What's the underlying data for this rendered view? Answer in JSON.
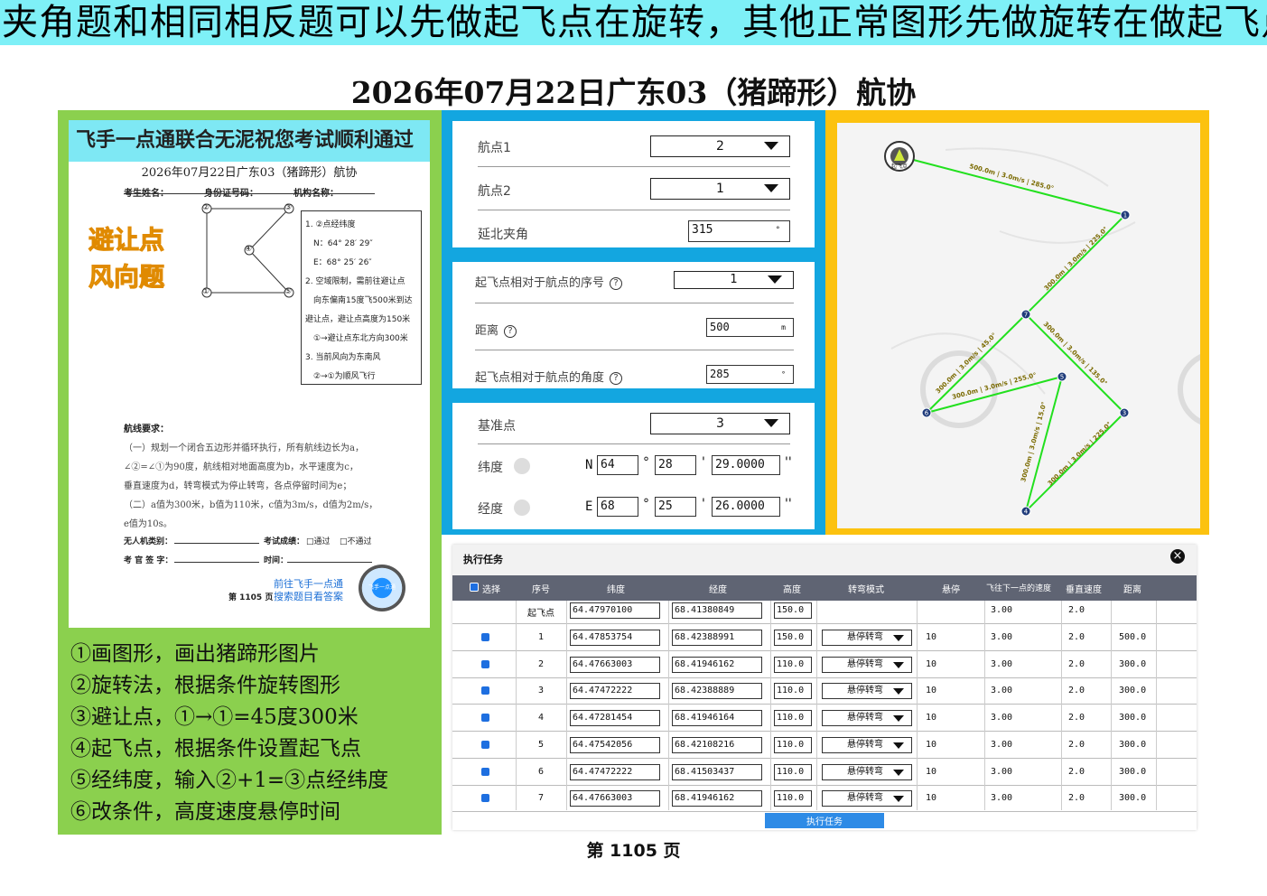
{
  "banner": {
    "text": "夹角题和相同相反题可以先做起飞点在旋转，其他正常图形先做旋转在做起飞点"
  },
  "title": "2026年07月22日广东03（猪蹄形）航协",
  "left": {
    "paper": {
      "header": "飞手一点通联合无泥祝您考试顺利通过",
      "title": "2026年07月22日广东03（猪蹄形）航协",
      "candidate_fields": [
        "考生姓名：",
        "身份证号码：",
        "机构名称："
      ],
      "tag_line1": "避让点",
      "tag_line2": "风向题",
      "conditions": [
        "1. ②点经纬度",
        "N：64° 28′ 29″",
        "E：68° 25′ 26″",
        "2. 空域限制，需前往避让点",
        "向东偏南15度飞500米到达",
        "避让点，避让点高度为150米",
        "①→避让点东北方向300米",
        "3. 当前风向为东南风",
        "②→①为顺风飞行"
      ],
      "route_title": "航线要求：",
      "route_lines": [
        "（一）规划一个闭合五边形并循环执行，所有航线边长为a，",
        "∠②=∠①为90度，航线相对地面高度为b，水平速度为c，",
        "垂直速度为d，转弯模式为停止转弯，各点停留时间为e；",
        "（二）a值为300米，b值为110米，c值为3m/s，d值为2m/s，",
        "e值为10s。"
      ],
      "uav_type": "无人机类别：",
      "result_label": "考试成绩：",
      "pass": "□通过",
      "fail": "□不通过",
      "examiner": "考 官 签 字：",
      "time_label": "时间：",
      "footer_link1": "前往飞手一点通",
      "footer_link2": "搜索题目看答案",
      "footer_page": "第 1105 页",
      "qr_label": "飞手一点通",
      "shape_points": [
        "②",
        "③",
        "④",
        "①",
        "⑤"
      ]
    },
    "steps": [
      "①画图形，画出猪蹄形图片",
      "②旋转法，根据条件旋转图形",
      "③避让点，①→①=45度300米",
      "④起飞点，根据条件设置起飞点",
      "⑤经纬度，输入②+1=③点经纬度",
      "⑥改条件，高度速度悬停时间"
    ]
  },
  "mid": {
    "box1": {
      "waypoint1_label": "航点1",
      "waypoint1_value": "2",
      "waypoint2_label": "航点2",
      "waypoint2_value": "1",
      "angle_label": "延北夹角",
      "angle_value": "315",
      "angle_unit": "°"
    },
    "box2": {
      "seq_label": "起飞点相对于航点的序号",
      "seq_value": "1",
      "dist_label": "距离",
      "dist_value": "500",
      "dist_unit": "m",
      "angle_label": "起飞点相对于航点的角度",
      "angle_value": "285",
      "angle_unit": "°"
    },
    "box3": {
      "base_label": "基准点",
      "base_value": "3",
      "lat_label": "纬度",
      "lat_prefix": "N",
      "lat_deg": "64",
      "lat_min": "28",
      "lat_sec": "29.0000",
      "lon_label": "经度",
      "lon_prefix": "E",
      "lon_deg": "68",
      "lon_min": "25",
      "lon_sec": "26.0000",
      "deg_sym": "°",
      "min_sym": "'",
      "sec_sym": "''"
    }
  },
  "map": {
    "home_label": "起飞点",
    "nodes": [
      "1",
      "7",
      "6",
      "5",
      "3",
      "4"
    ],
    "edge_labels": [
      "500.0m | 3.0m/s | 285.0°",
      "300.0m | 3.0m/s | 225.0°",
      "300.0m | 3.0m/s | 45.0°",
      "300.0m | 3.0m/s | 135.0°",
      "300.0m | 3.0m/s | 255.0°",
      "300.0m | 3.0m/s | 15.0°",
      "300.0m | 3.0m/s | 225.0°"
    ]
  },
  "task": {
    "title": "执行任务",
    "close": "×",
    "columns": [
      "选择",
      "序号",
      "纬度",
      "经度",
      "高度",
      "转弯模式",
      "悬停",
      "飞往下一点的速度",
      "垂直速度",
      "距离"
    ],
    "takeoff_row": {
      "seq": "起飞点",
      "lat": "64.47970100",
      "lon": "68.41380849",
      "alt": "150.0",
      "speed": "3.00",
      "vspeed": "2.0"
    },
    "rows": [
      {
        "seq": "1",
        "lat": "64.47853754",
        "lon": "68.42388991",
        "alt": "150.0",
        "mode": "悬停转弯",
        "hover": "10",
        "speed": "3.00",
        "vspeed": "2.0",
        "dist": "500.0"
      },
      {
        "seq": "2",
        "lat": "64.47663003",
        "lon": "68.41946162",
        "alt": "110.0",
        "mode": "悬停转弯",
        "hover": "10",
        "speed": "3.00",
        "vspeed": "2.0",
        "dist": "300.0"
      },
      {
        "seq": "3",
        "lat": "64.47472222",
        "lon": "68.42388889",
        "alt": "110.0",
        "mode": "悬停转弯",
        "hover": "10",
        "speed": "3.00",
        "vspeed": "2.0",
        "dist": "300.0"
      },
      {
        "seq": "4",
        "lat": "64.47281454",
        "lon": "68.41946164",
        "alt": "110.0",
        "mode": "悬停转弯",
        "hover": "10",
        "speed": "3.00",
        "vspeed": "2.0",
        "dist": "300.0"
      },
      {
        "seq": "5",
        "lat": "64.47542056",
        "lon": "68.42108216",
        "alt": "110.0",
        "mode": "悬停转弯",
        "hover": "10",
        "speed": "3.00",
        "vspeed": "2.0",
        "dist": "300.0"
      },
      {
        "seq": "6",
        "lat": "64.47472222",
        "lon": "68.41503437",
        "alt": "110.0",
        "mode": "悬停转弯",
        "hover": "10",
        "speed": "3.00",
        "vspeed": "2.0",
        "dist": "300.0"
      },
      {
        "seq": "7",
        "lat": "64.47663003",
        "lon": "68.41946162",
        "alt": "110.0",
        "mode": "悬停转弯",
        "hover": "10",
        "speed": "3.00",
        "vspeed": "2.0",
        "dist": "300.0"
      }
    ],
    "exec_button": "执行任务"
  },
  "page_number": "第 1105 页",
  "colors": {
    "banner": "#7ef0f7",
    "left_panel": "#8bd04e",
    "mid_panel": "#13a6e0",
    "map_panel": "#fcc20f",
    "route": "#22e01e",
    "table_header": "#5f6473",
    "checkbox": "#1e6fe0"
  }
}
